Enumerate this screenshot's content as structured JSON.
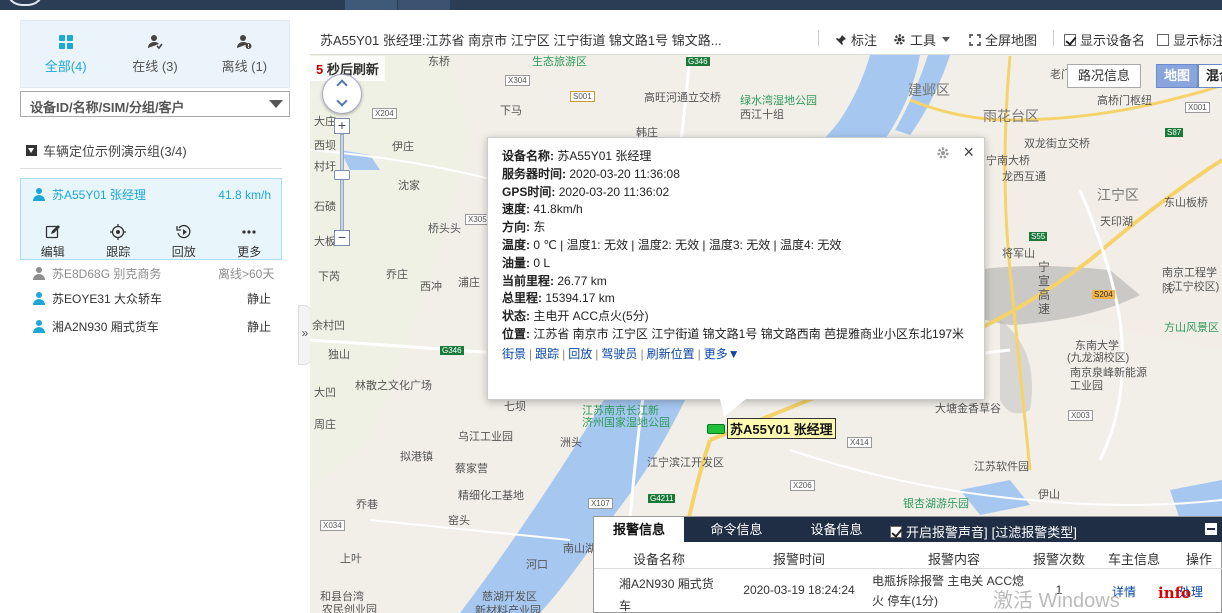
{
  "status_tabs": [
    {
      "label": "全部(4)",
      "icon": "grid-icon",
      "active": true
    },
    {
      "label": "在线 (3)",
      "icon": "person-check-icon",
      "active": false
    },
    {
      "label": "离线 (1)",
      "icon": "person-alert-icon",
      "active": false
    }
  ],
  "device_filter": {
    "value": "设备ID/名称/SIM/分组/客户"
  },
  "group": {
    "label": "车辆定位示例演示组(3/4)"
  },
  "vehicles": [
    {
      "name": "苏A55Y01 张经理",
      "status": "41.8 km/h",
      "color": "#1ca7d7",
      "selected": true
    },
    {
      "name": "苏E8D68G 别克商务",
      "status": "离线>60天",
      "color": "#8e8e8e"
    },
    {
      "name": "苏EOYE31 大众轿车",
      "status": "静止",
      "color": "#1ca7d7"
    },
    {
      "name": "湘A2N930 厢式货车",
      "status": "静止",
      "color": "#1ca7d7"
    }
  ],
  "vehicle_actions": [
    {
      "label": "编辑",
      "icon": "edit-icon"
    },
    {
      "label": "跟踪",
      "icon": "target-icon"
    },
    {
      "label": "回放",
      "icon": "replay-icon"
    },
    {
      "label": "更多",
      "icon": "more-icon"
    }
  ],
  "collapse": "»",
  "toolbar": {
    "title": "苏A55Y01 张经理:江苏省 南京市 江宁区 江宁街道 锦文路1号 锦文路...",
    "mark": "标注",
    "tools": "工具",
    "fullscreen": "全屏地图",
    "show_device_name": "显示设备名",
    "show_mark_name": "显示标注名"
  },
  "refresh": {
    "seconds": "5",
    "text": " 秒后刷新"
  },
  "map_controls": {
    "traffic": "路况信息",
    "map": "地图",
    "hybrid": "混合",
    "zoom_in": "+",
    "zoom_out": "−"
  },
  "map_labels": [
    {
      "t": "东桥"
    },
    {
      "t": "生态旅游区"
    },
    {
      "t": "高旺河通立交桥"
    },
    {
      "t": "绿水湾湿地公园"
    },
    {
      "t": "西江十组"
    },
    {
      "t": "韩庄"
    },
    {
      "t": "建邺区"
    },
    {
      "t": "雨花台区"
    },
    {
      "t": "高桥门枢纽"
    },
    {
      "t": "双龙街立交桥"
    },
    {
      "t": "宁南大桥"
    },
    {
      "t": "龙西互通"
    },
    {
      "t": "江宁区"
    },
    {
      "t": "东山板桥"
    },
    {
      "t": "天印湖"
    },
    {
      "t": "南京工程学院"
    },
    {
      "t": "(江宁校区)"
    },
    {
      "t": "将军山"
    },
    {
      "t": "宁"
    },
    {
      "t": "宣"
    },
    {
      "t": "高"
    },
    {
      "t": "速"
    },
    {
      "t": "方山风景区"
    },
    {
      "t": "东南大学"
    },
    {
      "t": "(九龙湖校区)"
    },
    {
      "t": "南京泉峰新能源"
    },
    {
      "t": "工业园"
    },
    {
      "t": "大塘金香草谷"
    },
    {
      "t": "江苏软件园"
    },
    {
      "t": "银杏湖游乐园"
    },
    {
      "t": "伊山"
    },
    {
      "t": "江宁滨江开发区"
    },
    {
      "t": "江苏南京长江新"
    },
    {
      "t": "济州国家湿地公园"
    },
    {
      "t": "洲头"
    },
    {
      "t": "南山湖"
    },
    {
      "t": "慈湖开发区"
    },
    {
      "t": "新材料产业园"
    },
    {
      "t": "和县台湾"
    },
    {
      "t": "农民创业园"
    },
    {
      "t": "乌江工业园"
    },
    {
      "t": "精细化工基地"
    },
    {
      "t": "林散之文化广场"
    },
    {
      "t": "独山"
    },
    {
      "t": "余村凹"
    },
    {
      "t": "张桥"
    },
    {
      "t": "下马"
    },
    {
      "t": "伊庄"
    },
    {
      "t": "沈家"
    },
    {
      "t": "桥头头"
    },
    {
      "t": "石碛"
    },
    {
      "t": "乔庄"
    },
    {
      "t": "西冲"
    },
    {
      "t": "浦庄"
    },
    {
      "t": "大板"
    },
    {
      "t": "下芮"
    },
    {
      "t": "大庄"
    },
    {
      "t": "河口"
    },
    {
      "t": "窑头"
    },
    {
      "t": "蔡家营"
    },
    {
      "t": "拟港镇"
    },
    {
      "t": "上叶"
    },
    {
      "t": "洲头"
    },
    {
      "t": "七坝"
    },
    {
      "t": "大凹"
    },
    {
      "t": "村圩"
    },
    {
      "t": "西坝"
    },
    {
      "t": "周庄"
    },
    {
      "t": "乔巷"
    },
    {
      "t": "老门东"
    },
    {
      "t": "S001"
    },
    {
      "t": "G346"
    },
    {
      "t": "X304"
    },
    {
      "t": "X204"
    },
    {
      "t": "X305"
    },
    {
      "t": "X414"
    },
    {
      "t": "X206"
    },
    {
      "t": "X107"
    },
    {
      "t": "G4211"
    },
    {
      "t": "X034"
    },
    {
      "t": "S204"
    },
    {
      "t": "X003"
    },
    {
      "t": "S55"
    },
    {
      "t": "S87"
    },
    {
      "t": "X001"
    },
    {
      "t": "G346"
    }
  ],
  "popup": {
    "device_name_label": "设备名称:",
    "device_name": "苏A55Y01 张经理",
    "server_time_label": "服务器时间:",
    "server_time": "2020-03-20 11:36:08",
    "gps_time_label": "GPS时间:",
    "gps_time": "2020-03-20 11:36:02",
    "speed_label": "速度:",
    "speed": "41.8km/h",
    "direction_label": "方向:",
    "direction": "东",
    "temperature_label": "温度:",
    "temperature": "0 ℃ | 温度1: 无效 | 温度2: 无效 | 温度3: 无效 | 温度4: 无效",
    "oil_label": "油量:",
    "oil": "0 L",
    "mileage_label": "当前里程:",
    "mileage": "26.77 km",
    "total_mileage_label": "总里程:",
    "total_mileage": "15394.17 km",
    "status_label": "状态:",
    "status": "主电开 ACC点火(5分)",
    "location_label": "位置:",
    "location": "江苏省 南京市 江宁区 江宁街道 锦文路1号 锦文路西南 芭提雅商业小区东北197米",
    "links": [
      "街景",
      "跟踪",
      "回放",
      "驾驶员",
      "刷新位置",
      "更多▼"
    ],
    "close": "×"
  },
  "vehicle_marker": {
    "label": "苏A55Y01 张经理"
  },
  "alarm_panel": {
    "tabs": [
      "报警信息",
      "命令信息",
      "设备信息"
    ],
    "sound_option": "开启报警声音]",
    "filter_option": "[过滤报警类型]",
    "headers": [
      "设备名称",
      "报警时间",
      "报警内容",
      "报警次数",
      "车主信息",
      "操作"
    ],
    "row": {
      "device": "湘A2N930 厢式货车",
      "time": "2020-03-19 18:24:24",
      "content": "电瓶拆除报警 主电关 ACC熄火 停车(1分)",
      "count": "1",
      "owner": "详情",
      "action": "处理"
    }
  },
  "watermark": "激活 Windows",
  "badge": "info"
}
